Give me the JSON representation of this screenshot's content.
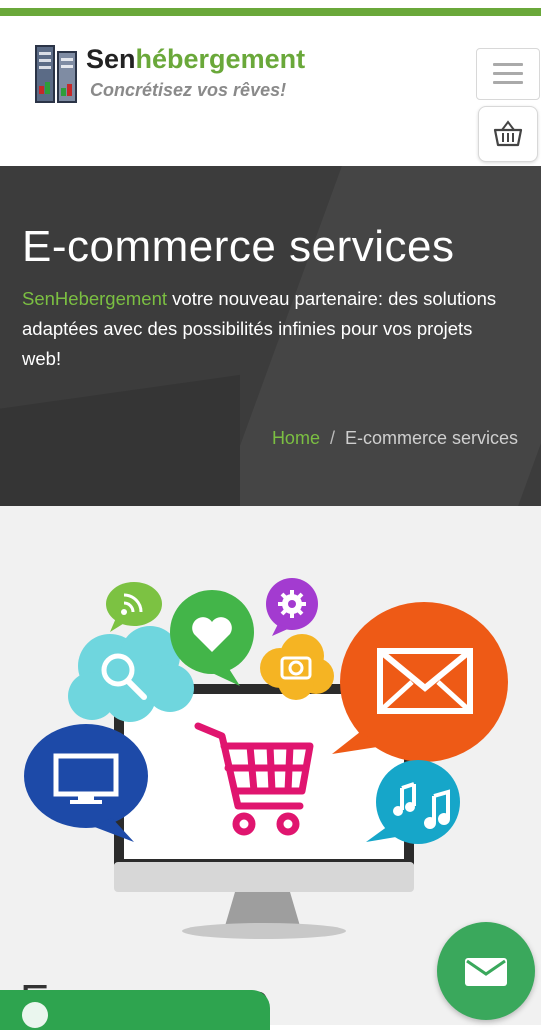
{
  "header": {
    "logo_name_part1": "Sen",
    "logo_name_part2": "hébergement",
    "logo_tagline": "Concrétisez vos rêves!",
    "menu_icon": "hamburger-icon",
    "cart_icon": "basket-icon"
  },
  "hero": {
    "title": "E-commerce services",
    "desc_brand": "SenHebergement",
    "desc_text": " votre nouveau partenaire: des solutions adaptées avec des possibilités infinies pour vos projets web!",
    "breadcrumb": {
      "home": "Home",
      "separator": "/",
      "current": "E-commerce services"
    }
  },
  "bottom": {
    "partial_title": "E-commerce"
  },
  "colors": {
    "brand_green": "#6aa83a",
    "hero_bg": "#3c3c3c",
    "fab_green": "#3aa85c"
  },
  "fab": {
    "mail_icon": "mail-icon",
    "chat_icon": "whatsapp-icon"
  }
}
